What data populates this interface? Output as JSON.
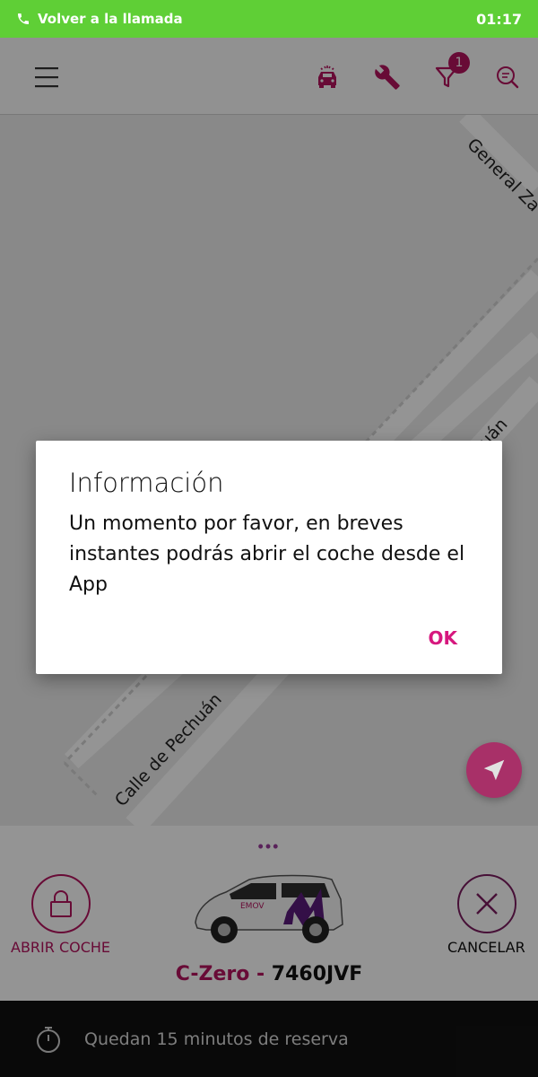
{
  "status_bar": {
    "call_text": "Volver a la llamada",
    "time": "01:17"
  },
  "header": {
    "filter_badge": "1",
    "icons": [
      "menu-icon",
      "car-wash-icon",
      "wrench-icon",
      "filter-icon",
      "search-icon"
    ]
  },
  "map": {
    "streets": [
      "General Za",
      "Calle de Pechuán",
      "uán"
    ]
  },
  "dialog": {
    "title": "Información",
    "message": "Un momento por favor, en breves instantes podrás abrir el coche desde el App",
    "ok_label": "OK"
  },
  "card": {
    "dots": "•••",
    "open_label": "ABRIR COCHE",
    "cancel_label": "CANCELAR",
    "model": "C-Zero",
    "separator": " - ",
    "plate": "7460JVF",
    "car_brand": "EMOV"
  },
  "footer": {
    "reservation_text": "Quedan 15 minutos de reserva"
  },
  "colors": {
    "accent": "#b3135e",
    "status_bar": "#5fcf36",
    "footer": "#111111"
  }
}
